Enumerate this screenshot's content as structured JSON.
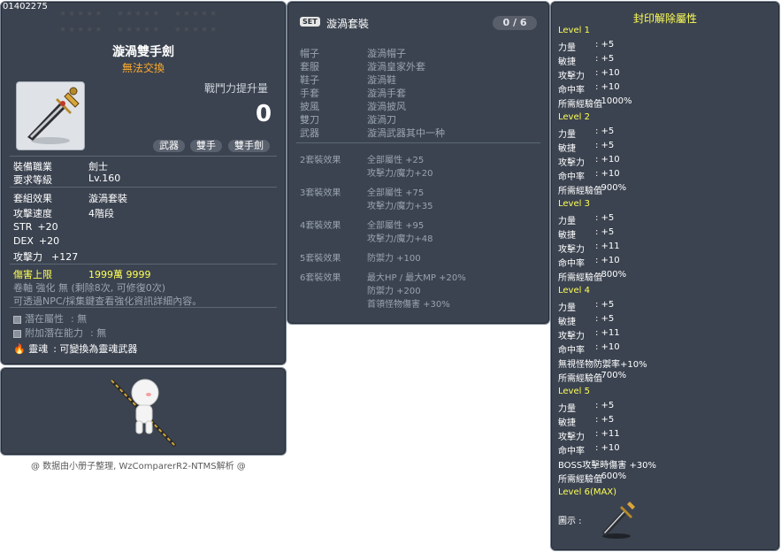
{
  "item": {
    "id": "01402275",
    "name": "漩渦雙手劍",
    "tradeable": "無法交換",
    "power_label": "戰鬥力提升量",
    "power_value": "0",
    "tags": [
      "武器",
      "雙手",
      "雙手劍"
    ],
    "stats": [
      {
        "label": "裝備職業",
        "value": "劍士"
      },
      {
        "label": "要求等級",
        "value": "Lv.160"
      },
      {
        "label": "套組效果",
        "value": "漩渦套裝"
      },
      {
        "label": "攻擊速度",
        "value": "4階段"
      },
      {
        "label": "STR",
        "value": "+20"
      },
      {
        "label": "DEX",
        "value": "+20"
      },
      {
        "label": "攻擊力",
        "value": "+127"
      }
    ],
    "damage_cap_label": "傷害上限",
    "damage_cap_value": "1999萬 9999",
    "scroll_line": "卷軸 強化 無 (剩除8次, 可修復0次)",
    "enhance_line": "可透過NPC/採集鍵查看強化資訊詳細內容。",
    "potential_label": "潛在屬性",
    "potential_value": ": 無",
    "add_potential_label": "附加潛在能力",
    "add_potential_value": ": 無",
    "soul_label": "靈魂",
    "soul_value": ": 可變換為靈魂武器"
  },
  "footer_note": "@ 数据由小册子整理, WzComparerR2-NTMS解析 @",
  "set": {
    "badge": "SET",
    "title": "漩渦套裝",
    "count": "0 / 6",
    "items": [
      {
        "slot": "帽子",
        "name": "漩渦帽子"
      },
      {
        "slot": "套服",
        "name": "漩渦皇家外套"
      },
      {
        "slot": "鞋子",
        "name": "漩渦鞋"
      },
      {
        "slot": "手套",
        "name": "漩渦手套"
      },
      {
        "slot": "披風",
        "name": "漩渦披风"
      },
      {
        "slot": "雙刀",
        "name": "漩渦刀"
      },
      {
        "slot": "武器",
        "name": "漩渦武器其中一种"
      }
    ],
    "bonuses": [
      {
        "label": "2套裝效果",
        "lines": [
          "全部屬性 +25",
          "攻擊力/魔力+20"
        ]
      },
      {
        "label": "3套裝效果",
        "lines": [
          "全部屬性 +75",
          "攻擊力/魔力+35"
        ]
      },
      {
        "label": "4套裝效果",
        "lines": [
          "全部屬性 +95",
          "攻擊力/魔力+48"
        ]
      },
      {
        "label": "5套裝效果",
        "lines": [
          "防禦力 +100"
        ]
      },
      {
        "label": "6套裝效果",
        "lines": [
          "最大HP / 最大MP +20%",
          "防禦力 +200",
          "首領怪物傷害 +30%"
        ]
      }
    ]
  },
  "seal": {
    "title": "封印解除屬性",
    "levels": [
      {
        "level": "Level 1",
        "lines": [
          [
            "力量",
            ": +5"
          ],
          [
            "敏捷",
            ": +5"
          ],
          [
            "攻擊力",
            ": +10"
          ],
          [
            "命中率",
            ": +10"
          ],
          [
            "所需經驗值",
            ": 1000%"
          ]
        ]
      },
      {
        "level": "Level 2",
        "lines": [
          [
            "力量",
            ": +5"
          ],
          [
            "敏捷",
            ": +5"
          ],
          [
            "攻擊力",
            ": +10"
          ],
          [
            "命中率",
            ": +10"
          ],
          [
            "所需經驗值",
            ": 900%"
          ]
        ]
      },
      {
        "level": "Level 3",
        "lines": [
          [
            "力量",
            ": +5"
          ],
          [
            "敏捷",
            ": +5"
          ],
          [
            "攻擊力",
            ": +11"
          ],
          [
            "命中率",
            ": +10"
          ],
          [
            "所需經驗值",
            ": 800%"
          ]
        ]
      },
      {
        "level": "Level 4",
        "lines": [
          [
            "力量",
            ": +5"
          ],
          [
            "敏捷",
            ": +5"
          ],
          [
            "攻擊力",
            ": +11"
          ],
          [
            "命中率",
            ": +10"
          ],
          [
            "無視怪物防禦率",
            "+10%"
          ],
          [
            "所需經驗值",
            ": 700%"
          ]
        ]
      },
      {
        "level": "Level 5",
        "lines": [
          [
            "力量",
            ": +5"
          ],
          [
            "敏捷",
            ": +5"
          ],
          [
            "攻擊力",
            ": +11"
          ],
          [
            "命中率",
            ": +10"
          ],
          [
            "BOSS攻擊時傷害",
            " +30%"
          ],
          [
            "所需經驗值",
            ": 600%"
          ]
        ]
      },
      {
        "level": "Level 6(MAX)",
        "lines": []
      }
    ],
    "icon_label": "圖示 :"
  },
  "colors": {
    "panel_bg": "#3b4350",
    "panel_border": "#7d8796",
    "level_yellow": "#ffff55",
    "gold": "#ffd35a",
    "tradeable_orange": "#ffaa2b"
  }
}
